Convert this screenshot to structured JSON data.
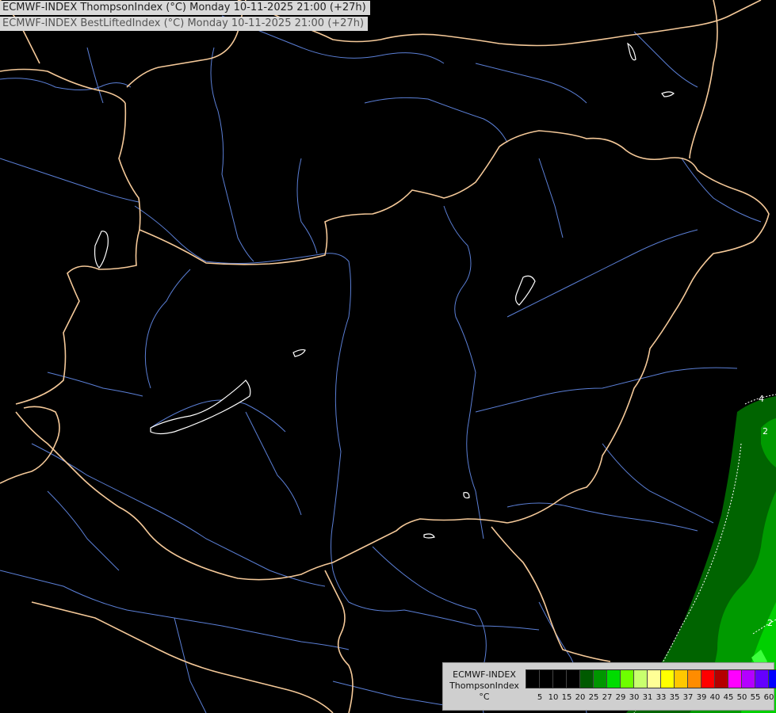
{
  "header": {
    "line1": "ECMWF-INDEX ThompsonIndex (°C) Monday 10-11-2025 21:00 (+27h)",
    "line2": "ECMWF-INDEX BestLiftedIndex (°C) Monday 10-11-2025 21:00 (+27h)"
  },
  "legend": {
    "model": "ECMWF-INDEX",
    "parameter": "ThompsonIndex",
    "unit": "°C",
    "ticks": [
      "5",
      "10",
      "15",
      "20",
      "25",
      "27",
      "29",
      "30",
      "31",
      "33",
      "35",
      "37",
      "39",
      "40",
      "45",
      "50",
      "55",
      "60"
    ],
    "colors": [
      "#000000",
      "#000000",
      "#000000",
      "#000000",
      "#005a00",
      "#009600",
      "#00dc00",
      "#6eff00",
      "#c8ff6e",
      "#ffff96",
      "#ffff00",
      "#ffc800",
      "#ff8c00",
      "#ff0000",
      "#b40000",
      "#ff00ff",
      "#b400ff",
      "#6400ff",
      "#0000ff"
    ]
  },
  "map": {
    "contour_labels": [
      "4",
      "2",
      "2"
    ],
    "colors": {
      "background": "#000000",
      "borders": "#f5c999",
      "rivers": "#5b7fd6",
      "lakes": "#ffffff",
      "field_dark": "#006400",
      "field_mid": "#009a00",
      "field_light": "#00d000",
      "contour": "#ffffff"
    }
  }
}
